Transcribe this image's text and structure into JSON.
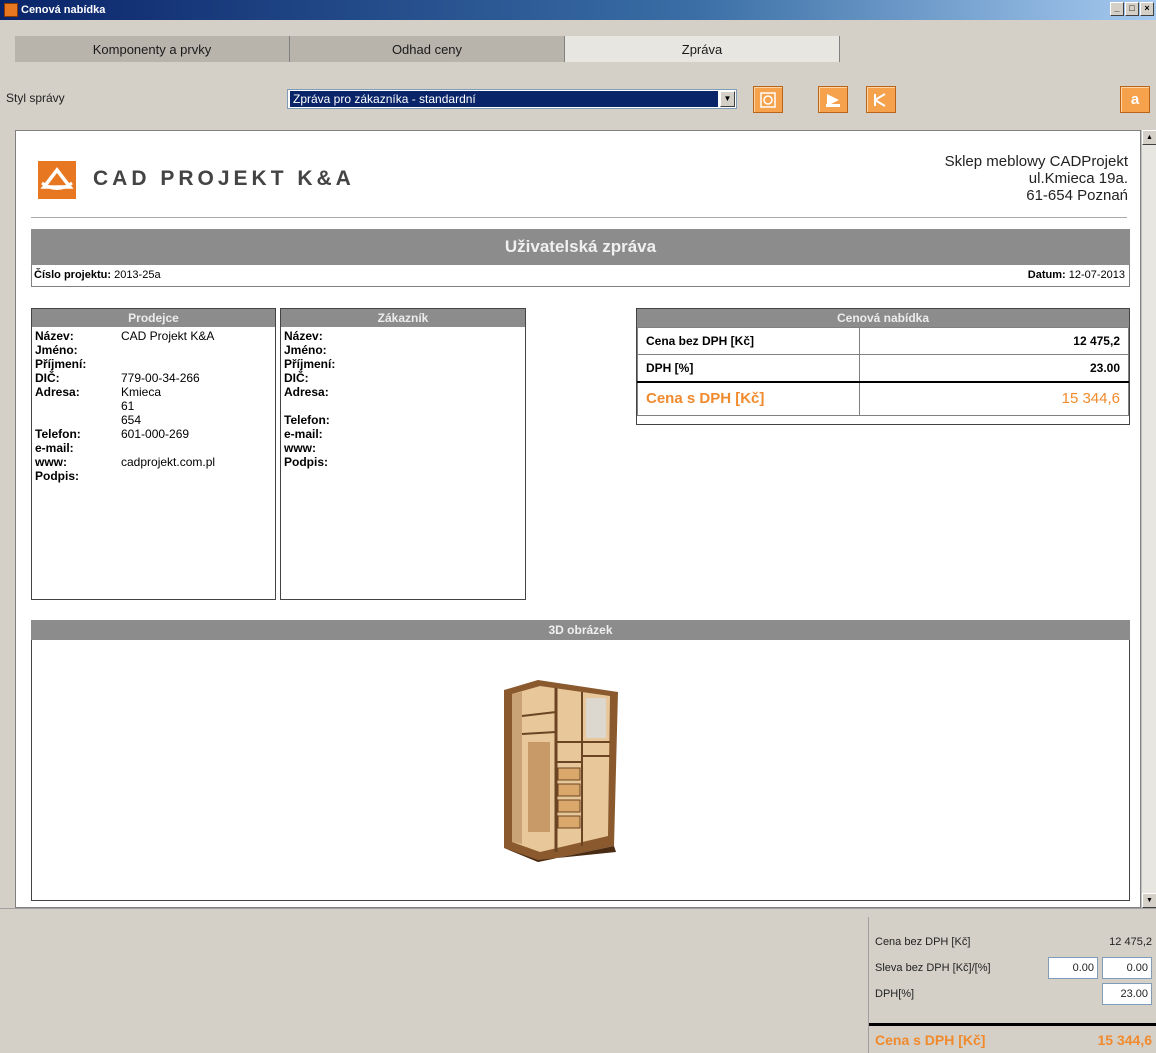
{
  "window": {
    "title": "Cenová nabídka"
  },
  "tabs": [
    "Komponenty a prvky",
    "Odhad ceny",
    "Zpráva"
  ],
  "toolbar": {
    "style_label": "Styl správy",
    "style_value": "Zpráva pro zákazníka - standardní",
    "buttons": [
      "refresh-icon",
      "export-pdf-icon",
      "export-word-icon",
      "about-icon"
    ]
  },
  "report": {
    "logo_text": "CAD PROJEKT K&A",
    "shop": {
      "line1": "Sklep meblowy CADProjekt",
      "line2": "ul.Kmieca 19a.",
      "line3": "61-654 Poznań"
    },
    "title": "Uživatelská zpráva",
    "project_label": "Číslo projektu:",
    "project_value": "2013-25a",
    "date_label": "Datum:",
    "date_value": "12-07-2013",
    "seller": {
      "header": "Prodejce",
      "fields": [
        {
          "k": "Název:",
          "v": "CAD Projekt K&A"
        },
        {
          "k": "Jméno:",
          "v": ""
        },
        {
          "k": "Příjmení:",
          "v": ""
        },
        {
          "k": "DIČ:",
          "v": "779-00-34-266"
        },
        {
          "k": "Adresa:",
          "v": "Kmieca\n61\n654"
        },
        {
          "k": "Telefon:",
          "v": "601-000-269"
        },
        {
          "k": "e-mail:",
          "v": ""
        },
        {
          "k": "www:",
          "v": "cadprojekt.com.pl"
        },
        {
          "k": "Podpis:",
          "v": ""
        }
      ]
    },
    "customer": {
      "header": "Zákazník",
      "fields": [
        {
          "k": "Název:",
          "v": ""
        },
        {
          "k": "Jméno:",
          "v": ""
        },
        {
          "k": "Příjmení:",
          "v": ""
        },
        {
          "k": "DIČ:",
          "v": ""
        },
        {
          "k": "Adresa:",
          "v": "\n\n"
        },
        {
          "k": "Telefon:",
          "v": ""
        },
        {
          "k": "e-mail:",
          "v": ""
        },
        {
          "k": "www:",
          "v": ""
        },
        {
          "k": "Podpis:",
          "v": ""
        }
      ]
    },
    "offer": {
      "header": "Cenová nabídka",
      "net_label": "Cena bez DPH [Kč]",
      "net_value": "12 475,2",
      "vat_label": "DPH [%]",
      "vat_value": "23.00",
      "gross_label": "Cena s DPH [Kč]",
      "gross_value": "15 344,6"
    },
    "image_header": "3D obrázek"
  },
  "summary": {
    "net_label": "Cena bez DPH [Kč]",
    "net_value": "12 475,2",
    "discount_label": "Sleva bez DPH [Kč]/[%]",
    "discount_czk": "0.00",
    "discount_pct": "0.00",
    "vat_label": "DPH[%]",
    "vat_value": "23.00",
    "gross_label": "Cena s DPH [Kč]",
    "gross_value": "15 344,6"
  },
  "colors": {
    "accent": "#f08a2c",
    "band": "#8c8c8c",
    "selection": "#0a246a"
  }
}
